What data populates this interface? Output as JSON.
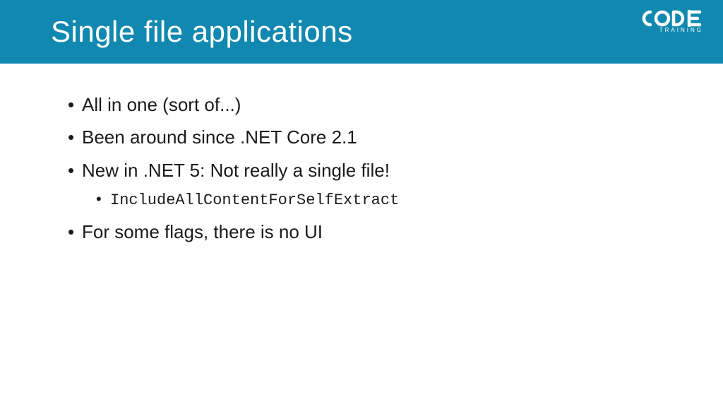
{
  "header": {
    "title": "Single file applications",
    "logo_text": "CODE",
    "logo_subtext": "TRAINING"
  },
  "bullets": [
    {
      "level": 1,
      "text": "All in one (sort of...)",
      "mono": false
    },
    {
      "level": 1,
      "text": "Been around since .NET Core 2.1",
      "mono": false
    },
    {
      "level": 1,
      "text": "New in .NET 5: Not really a single file!",
      "mono": false
    },
    {
      "level": 2,
      "text": "IncludeAllContentForSelfExtract",
      "mono": true
    },
    {
      "level": 1,
      "text": "For some flags, there is no UI",
      "mono": false
    }
  ]
}
